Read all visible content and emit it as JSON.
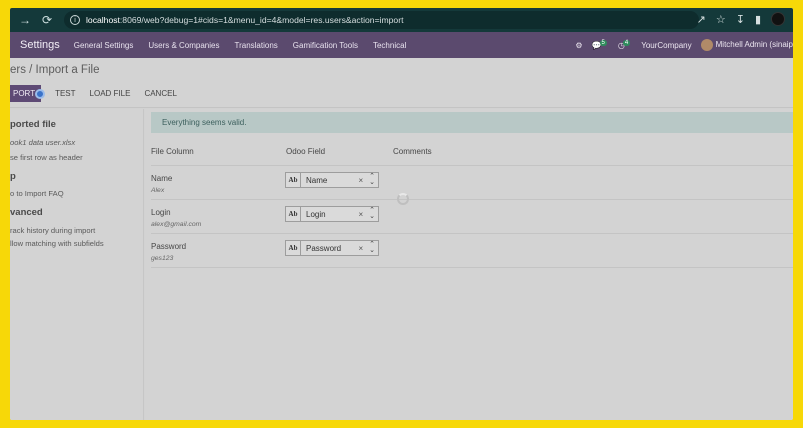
{
  "browser": {
    "url_host": "localhost",
    "url_rest": ":8069/web?debug=1#cids=1&menu_id=4&model=res.users&action=import"
  },
  "navbar": {
    "app": "Settings",
    "menu": [
      "General Settings",
      "Users & Companies",
      "Translations",
      "Gamification Tools",
      "Technical"
    ],
    "messages_badge": "5",
    "activities_badge": "4",
    "company": "YourCompany",
    "user": "Mitchell Admin (sinaip"
  },
  "breadcrumb": "ers / Import a File",
  "buttons": {
    "import": "PORT",
    "test": "TEST",
    "load_file": "LOAD FILE",
    "cancel": "CANCEL"
  },
  "sidebar": {
    "imported_file_heading": "ported file",
    "file_name": "ook1 data user.xlsx",
    "header_option": "se first row as header",
    "help_heading": "p",
    "help_link": "o to Import FAQ",
    "advanced_heading": "vanced",
    "track_history": "rack history during import",
    "allow_matching": "llow matching with subfields"
  },
  "alert": "Everything seems valid.",
  "table": {
    "headers": [
      "File Column",
      "Odoo Field",
      "Comments"
    ],
    "rows": [
      {
        "column": "Name",
        "sample": "Alex",
        "field": "Name"
      },
      {
        "column": "Login",
        "sample": "alex@gmail.com",
        "field": "Login"
      },
      {
        "column": "Password",
        "sample": "ges123",
        "field": "Password"
      }
    ]
  },
  "icons": {
    "field_type": "Ab",
    "clear": "×",
    "toggle": "⌃⌄"
  },
  "colors": {
    "frame": "#f7d808",
    "navbar": "#5b4a6e",
    "primary_button": "#5e4a75",
    "alert_bg": "#b8c8c6"
  }
}
